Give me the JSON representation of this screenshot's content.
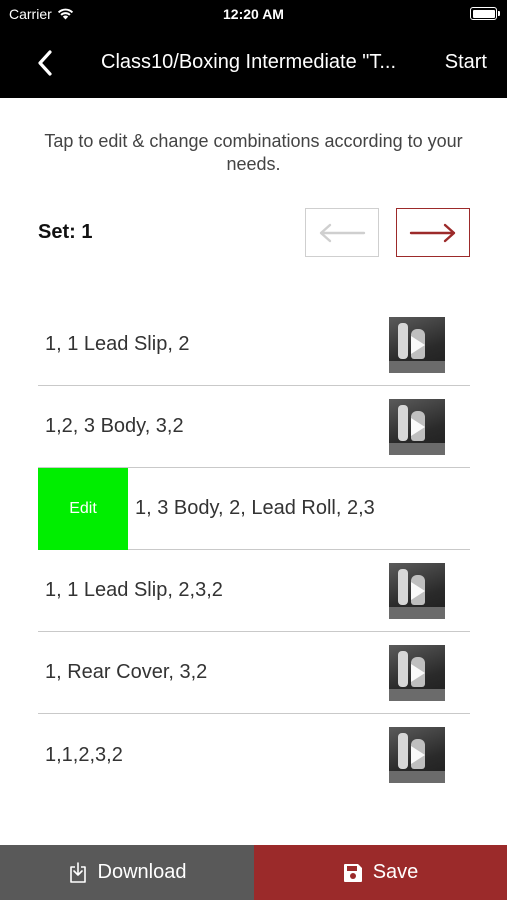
{
  "status_bar": {
    "carrier": "Carrier",
    "time": "12:20 AM"
  },
  "nav": {
    "back_icon": "chevron-left-icon",
    "title": "Class10/Boxing Intermediate \"T...",
    "start_label": "Start"
  },
  "instruction": "Tap to edit & change combinations according to your needs.",
  "set": {
    "label": "Set: 1"
  },
  "pager": {
    "prev_icon": "arrow-left-icon",
    "next_icon": "arrow-right-icon",
    "prev_color": "#cfcfcf",
    "next_color": "#9c2a2a"
  },
  "combinations": [
    {
      "text": "1, 1 Lead Slip, 2",
      "has_video": true
    },
    {
      "text": "1,2, 3 Body, 3,2",
      "has_video": true
    },
    {
      "text": "1, 3 Body, 2, Lead Roll, 2,3",
      "has_video": false,
      "edit_label": "Edit"
    },
    {
      "text": "1, 1 Lead Slip, 2,3,2",
      "has_video": true
    },
    {
      "text": "1, Rear Cover, 3,2",
      "has_video": true
    },
    {
      "text": "1,1,2,3,2",
      "has_video": true
    }
  ],
  "bottom_bar": {
    "download_label": "Download",
    "download_icon": "download-icon",
    "save_label": "Save",
    "save_icon": "floppy-disk-icon",
    "download_color": "#595959",
    "save_color": "#9b2a2a"
  },
  "colors": {
    "edit_green": "#00ee00",
    "accent_red": "#9b2a2a"
  }
}
